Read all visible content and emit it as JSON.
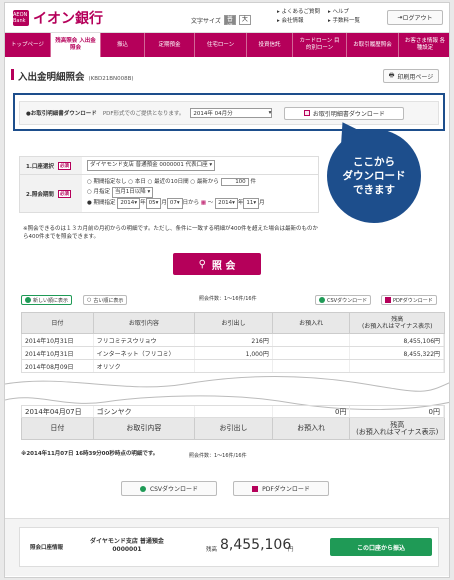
{
  "brand": {
    "logo_mark": "AEON Bank",
    "name": "イオン銀行"
  },
  "header": {
    "font_size_label": "文字サイズ",
    "font_size_options": [
      "普通",
      "大"
    ],
    "links": [
      "よくあるご質問",
      "ヘルプ",
      "会社情報",
      "手数料一覧"
    ],
    "logout": "ログアウト"
  },
  "nav": {
    "items": [
      "トップページ",
      "残高照会 入出金照会",
      "振込",
      "定期預金",
      "住宅ローン",
      "投資信託",
      "カードローン 目的別ローン",
      "お取引履歴照会",
      "お客さま情報 各種設定"
    ]
  },
  "page": {
    "title": "入出金明細照会",
    "code": "(KBD21BN008B)",
    "print": "印刷用ページ"
  },
  "download": {
    "label": "●お取引明細書ダウンロード",
    "note": "PDF形式でのご提供となります。",
    "month": "2014年 04月分",
    "button": "お取引明細書ダウンロード"
  },
  "bubble": {
    "line1": "ここから",
    "line2": "ダウンロード",
    "line3": "できます"
  },
  "form": {
    "account_label": "1.口座選択",
    "required": "必須",
    "account_value": "ダイヤモンド支店 普通預金 0000001 代表口座",
    "period_label": "2.照会期間",
    "opt1": "○ 期間指定なし ○ 本日 ○ 最近の10日間 ○ 最新から",
    "opt1_count": "100",
    "opt1_unit": "件",
    "opt2": "○ 月指定",
    "opt2_value": "当月1日以降",
    "opt3": "● 期間指定",
    "from_y": "2014",
    "from_m": "05",
    "from_d": "07",
    "from_suffix": "日から",
    "to_y": "2014",
    "to_m": "11",
    "y": "年",
    "m": "月",
    "tilde": "〜"
  },
  "note": "※照会できるのは１３カ月前の月初からの明細です。ただし、条件に一致する明細が400件を超えた場合は最新のものから400件までを照会できます。",
  "search_button": "照 会",
  "toolbar": {
    "newest": "新しい順に表示",
    "oldest": "古い順に表示",
    "count": "照会件数：1〜16件/16件",
    "csv": "CSVダウンロード",
    "pdf": "PDFダウンロード"
  },
  "table": {
    "headers": [
      "日付",
      "お取引内容",
      "お引出し",
      "お預入れ",
      "残高\n(お預入れはマイナス表示)"
    ],
    "rows": [
      [
        "2014年10月31日",
        "フリコミテスウリョウ",
        "216円",
        "",
        "8,455,106円"
      ],
      [
        "2014年10月31日",
        "インターネット（フリコミ）",
        "1,000円",
        "",
        "8,455,322円"
      ],
      [
        "2014年08月09日",
        "オリソク",
        "",
        "",
        ""
      ]
    ],
    "bottom_rows": [
      [
        "2014年04月07日",
        "ゴシンヤク",
        "",
        "0円",
        "0円"
      ]
    ],
    "footer_headers": [
      "日付",
      "お取引内容",
      "お引出し",
      "お預入れ",
      "残高\n(お預入れはマイナス表示)"
    ]
  },
  "footer": {
    "note": "※2014年11月07日 16時39分00秒時点の明細です。",
    "count": "照会件数：1〜16件/16件",
    "csv": "CSVダウンロード",
    "pdf": "PDFダウンロード"
  },
  "bottom": {
    "label": "照会口座情報",
    "account_line1": "ダイヤモンド支店 普通預金",
    "account_line2": "0000001",
    "balance_label": "残高",
    "balance": "8,455,106",
    "yen": "円",
    "transfer": "この口座から振込"
  },
  "colors": {
    "brand": "#b5005a",
    "callout": "#1d4e8c",
    "transfer": "#1f9a56"
  }
}
